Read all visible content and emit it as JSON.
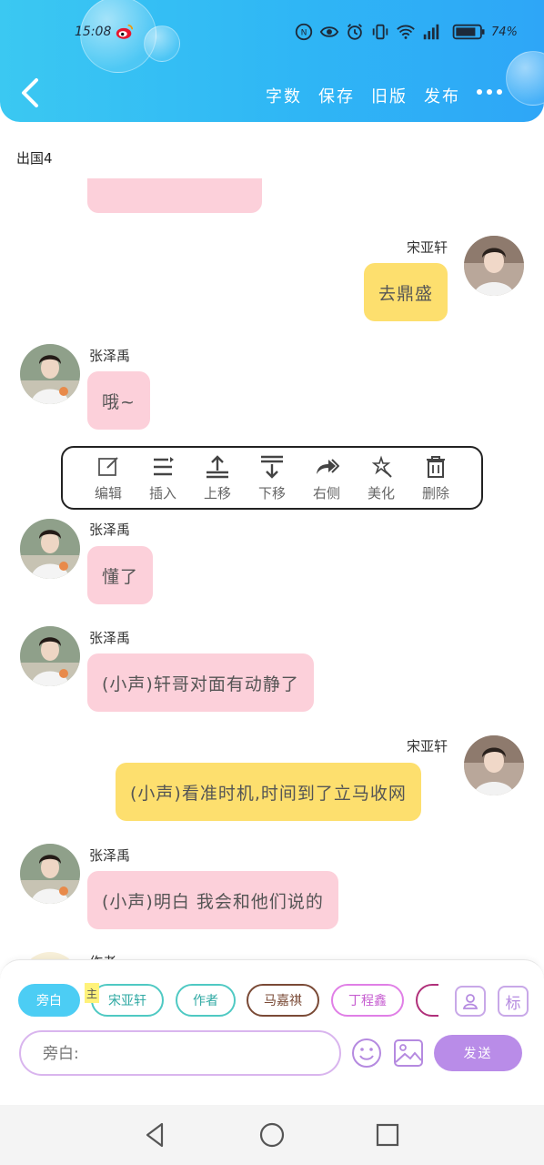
{
  "status_bar": {
    "time": "15:08",
    "battery": "74%"
  },
  "header": {
    "actions": {
      "word_count": "字数",
      "save": "保存",
      "old_version": "旧版",
      "publish": "发布"
    }
  },
  "doc_title": "出国4",
  "menu": {
    "edit": "编辑",
    "insert": "插入",
    "move_up": "上移",
    "move_down": "下移",
    "right_side": "右侧",
    "beautify": "美化",
    "delete": "删除"
  },
  "messages": [
    {
      "name": "宋亚轩",
      "text": "去鼎盛"
    },
    {
      "name": "张泽禹",
      "text": "哦~"
    },
    {
      "name": "张泽禹",
      "text": "懂了"
    },
    {
      "name": "张泽禹",
      "text": "(小声)轩哥对面有动静了"
    },
    {
      "name": "宋亚轩",
      "text": "(小声)看准时机,时间到了立马收网"
    },
    {
      "name": "张泽禹",
      "text": "(小声)明白 我会和他们说的"
    }
  ],
  "partial_bottom_name": "作者",
  "composer": {
    "roles": [
      "旁白",
      "宋亚轩",
      "作者",
      "马嘉祺",
      "丁程鑫"
    ],
    "main_tag": "主",
    "tag_button": "标",
    "input_placeholder": "旁白:",
    "send": "发送"
  },
  "colors": {
    "header": "#2fb6f5",
    "pink_bubble": "#fcd0da",
    "yellow_bubble": "#fddf6e",
    "send": "#b98ce8"
  }
}
